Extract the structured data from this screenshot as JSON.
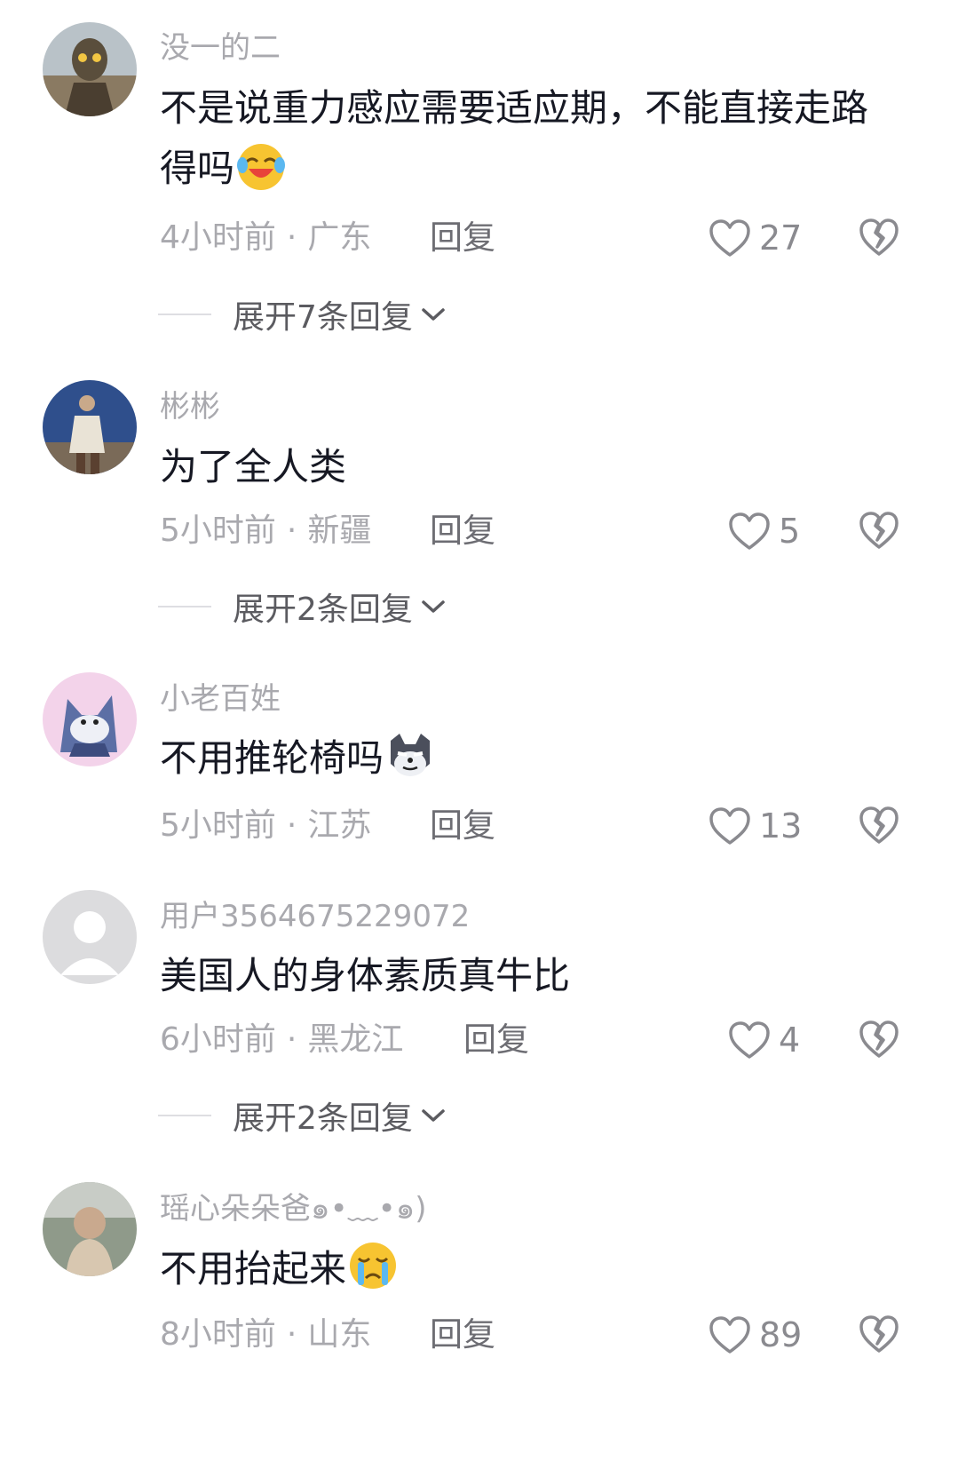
{
  "comments": [
    {
      "username": "没一的二",
      "content": "不是说重力感应需要适应期，不能直接走路得吗",
      "emoji": "laughing-crying-emoji",
      "time": "4小时前",
      "location": "广东",
      "reply_label": "回复",
      "likes": "27",
      "expand_label": "展开7条回复"
    },
    {
      "username": "彬彬",
      "content": "为了全人类",
      "time": "5小时前",
      "location": "新疆",
      "reply_label": "回复",
      "likes": "5",
      "expand_label": "展开2条回复"
    },
    {
      "username": "小老百姓",
      "content": "不用推轮椅吗",
      "emoji": "smirking-dog-emoji",
      "time": "5小时前",
      "location": "江苏",
      "reply_label": "回复",
      "likes": "13"
    },
    {
      "username": "用户3564675229072",
      "content": "美国人的身体素质真牛比",
      "time": "6小时前",
      "location": "黑龙江",
      "reply_label": "回复",
      "likes": "4",
      "expand_label": "展开2条回复"
    },
    {
      "username": "瑶心朵朵爸๑•﹏•๑)",
      "content": "不用抬起来",
      "emoji": "crying-emoji",
      "time": "8小时前",
      "location": "山东",
      "reply_label": "回复",
      "likes": "89"
    }
  ],
  "separator": "·",
  "colors": {
    "text_primary": "#161823",
    "text_secondary": "#a9a9ae",
    "icon": "#8a8a8f"
  }
}
